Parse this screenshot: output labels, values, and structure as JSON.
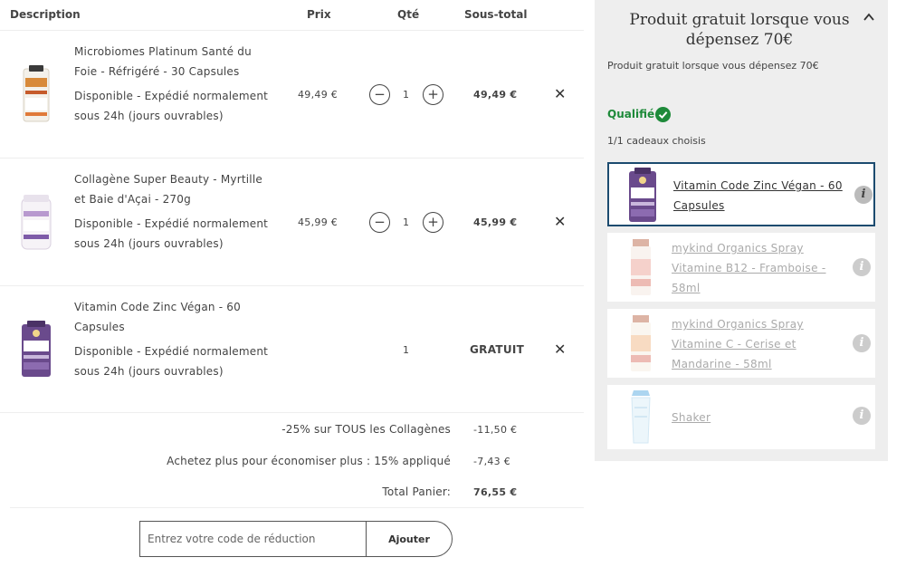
{
  "table": {
    "headers": {
      "description": "Description",
      "price": "Prix",
      "qty": "Qté",
      "subtotal": "Sous-total"
    }
  },
  "items": [
    {
      "name": "Microbiomes Platinum Santé du Foie - Réfrigéré - 30 Capsules",
      "availability": "Disponible  -  Expédié normalement sous 24h (jours ouvrables)",
      "price": "49,49 €",
      "qty": "1",
      "subtotal": "49,49 €",
      "remove": "✕"
    },
    {
      "name": "Collagène Super Beauty - Myrtille et Baie d'Açai - 270g",
      "availability": "Disponible  -  Expédié normalement sous 24h (jours ouvrables)",
      "price": "45,99 €",
      "qty": "1",
      "subtotal": "45,99 €",
      "remove": "✕"
    },
    {
      "name": "Vitamin Code Zinc Végan - 60 Capsules",
      "availability": "Disponible  -  Expédié normalement sous 24h (jours ouvrables)",
      "price": "",
      "qty": "1",
      "subtotal": "GRATUIT",
      "remove": "✕"
    }
  ],
  "qty_controls": {
    "minus": "−",
    "plus": "+"
  },
  "summary": {
    "discount1_label": "-25% sur TOUS les Collagènes",
    "discount1_value": "-11,50 €",
    "discount2_label": "Achetez plus pour économiser plus : 15% appliqué",
    "discount2_value": "-7,43 €",
    "total_label": "Total Panier:",
    "total_value": "76,55 €"
  },
  "coupon": {
    "placeholder": "Entrez votre code de réduction",
    "button": "Ajouter"
  },
  "sidebar": {
    "title": "Produit gratuit lorsque vous dépensez 70€",
    "subtitle": "Produit gratuit lorsque vous dépensez 70€",
    "qualified": "Qualifié",
    "count": "1/1 cadeaux choisis",
    "info_glyph": "i",
    "gifts": [
      {
        "name": "Vitamin Code Zinc Végan - 60 Capsules",
        "selected": true
      },
      {
        "name": "mykind Organics Spray Vitamine B12 - Framboise - 58ml",
        "selected": false
      },
      {
        "name": "mykind Organics Spray Vitamine C - Cerise et Mandarine - 58ml",
        "selected": false
      },
      {
        "name": "Shaker",
        "selected": false
      }
    ]
  },
  "colors": {
    "qualified": "#1e8a3a",
    "selected_border": "#1c4b6f",
    "panel_bg": "#eeeeee"
  },
  "icons": [
    "minus-icon",
    "plus-icon",
    "close-icon",
    "check-circle-icon",
    "chevron-up-icon",
    "info-icon"
  ]
}
